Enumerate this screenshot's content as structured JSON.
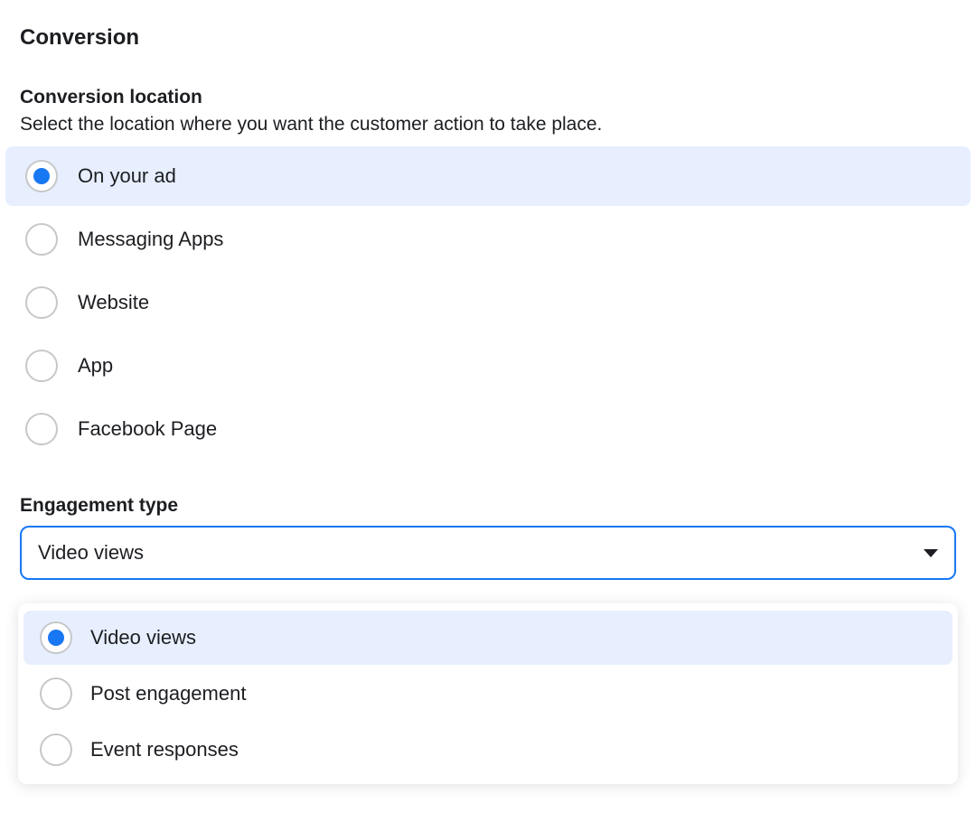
{
  "section": {
    "title": "Conversion"
  },
  "conversion_location": {
    "title": "Conversion location",
    "description": "Select the location where you want the customer action to take place.",
    "options": [
      {
        "label": "On your ad",
        "selected": true
      },
      {
        "label": "Messaging Apps",
        "selected": false
      },
      {
        "label": "Website",
        "selected": false
      },
      {
        "label": "App",
        "selected": false
      },
      {
        "label": "Facebook Page",
        "selected": false
      }
    ]
  },
  "engagement_type": {
    "title": "Engagement type",
    "selected_value": "Video views",
    "options": [
      {
        "label": "Video views",
        "selected": true
      },
      {
        "label": "Post engagement",
        "selected": false
      },
      {
        "label": "Event responses",
        "selected": false
      }
    ]
  }
}
